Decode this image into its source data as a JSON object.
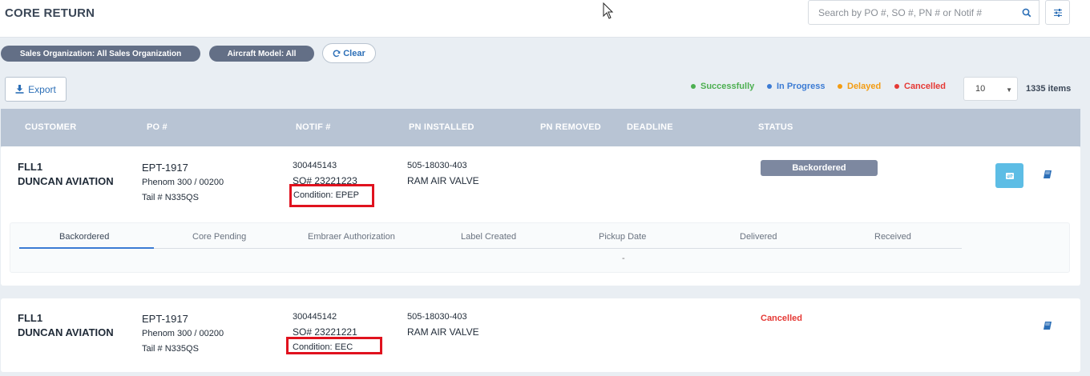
{
  "header": {
    "title": "CORE RETURN",
    "search_placeholder": "Search by PO #, SO #, PN # or Notif #"
  },
  "filters": [
    {
      "label": "Sales Organization: All Sales Organization"
    },
    {
      "label": "Aircraft Model: All"
    }
  ],
  "clear_label": "Clear",
  "export_label": "Export",
  "legend": [
    {
      "label": "Successfully",
      "color": "#4caf50"
    },
    {
      "label": "In Progress",
      "color": "#3b7bd4"
    },
    {
      "label": "Delayed",
      "color": "#f39c12"
    },
    {
      "label": "Cancelled",
      "color": "#e53935"
    }
  ],
  "pagination": {
    "page_size": "10",
    "items_count": "1335 items"
  },
  "columns": [
    "CUSTOMER",
    "PO #",
    "NOTIF #",
    "PN INSTALLED",
    "PN REMOVED",
    "DEADLINE",
    "STATUS"
  ],
  "rows": [
    {
      "customer_code": "FLL1",
      "customer_name": "DUNCAN AVIATION",
      "po": "EPT-1917",
      "model": "Phenom 300 / 00200",
      "tail": "Tail # N335QS",
      "notif": "300445143",
      "so": "SO# 23221223",
      "condition": "Condition: EPEP",
      "pn_installed": "505-18030-403",
      "pn_description": "RAM AIR VALVE",
      "status": "Backordered",
      "tracker": {
        "steps": [
          "Backordered",
          "Core Pending",
          "Embraer Authorization",
          "Label Created",
          "Pickup Date",
          "Delivered",
          "Received"
        ],
        "detail": "-"
      }
    },
    {
      "customer_code": "FLL1",
      "customer_name": "DUNCAN AVIATION",
      "po": "EPT-1917",
      "model": "Phenom 300 / 00200",
      "tail": "Tail # N335QS",
      "notif": "300445142",
      "so": "SO# 23221221",
      "condition": "Condition: EEC",
      "pn_installed": "505-18030-403",
      "pn_description": "RAM AIR VALVE",
      "status": "Cancelled"
    }
  ]
}
